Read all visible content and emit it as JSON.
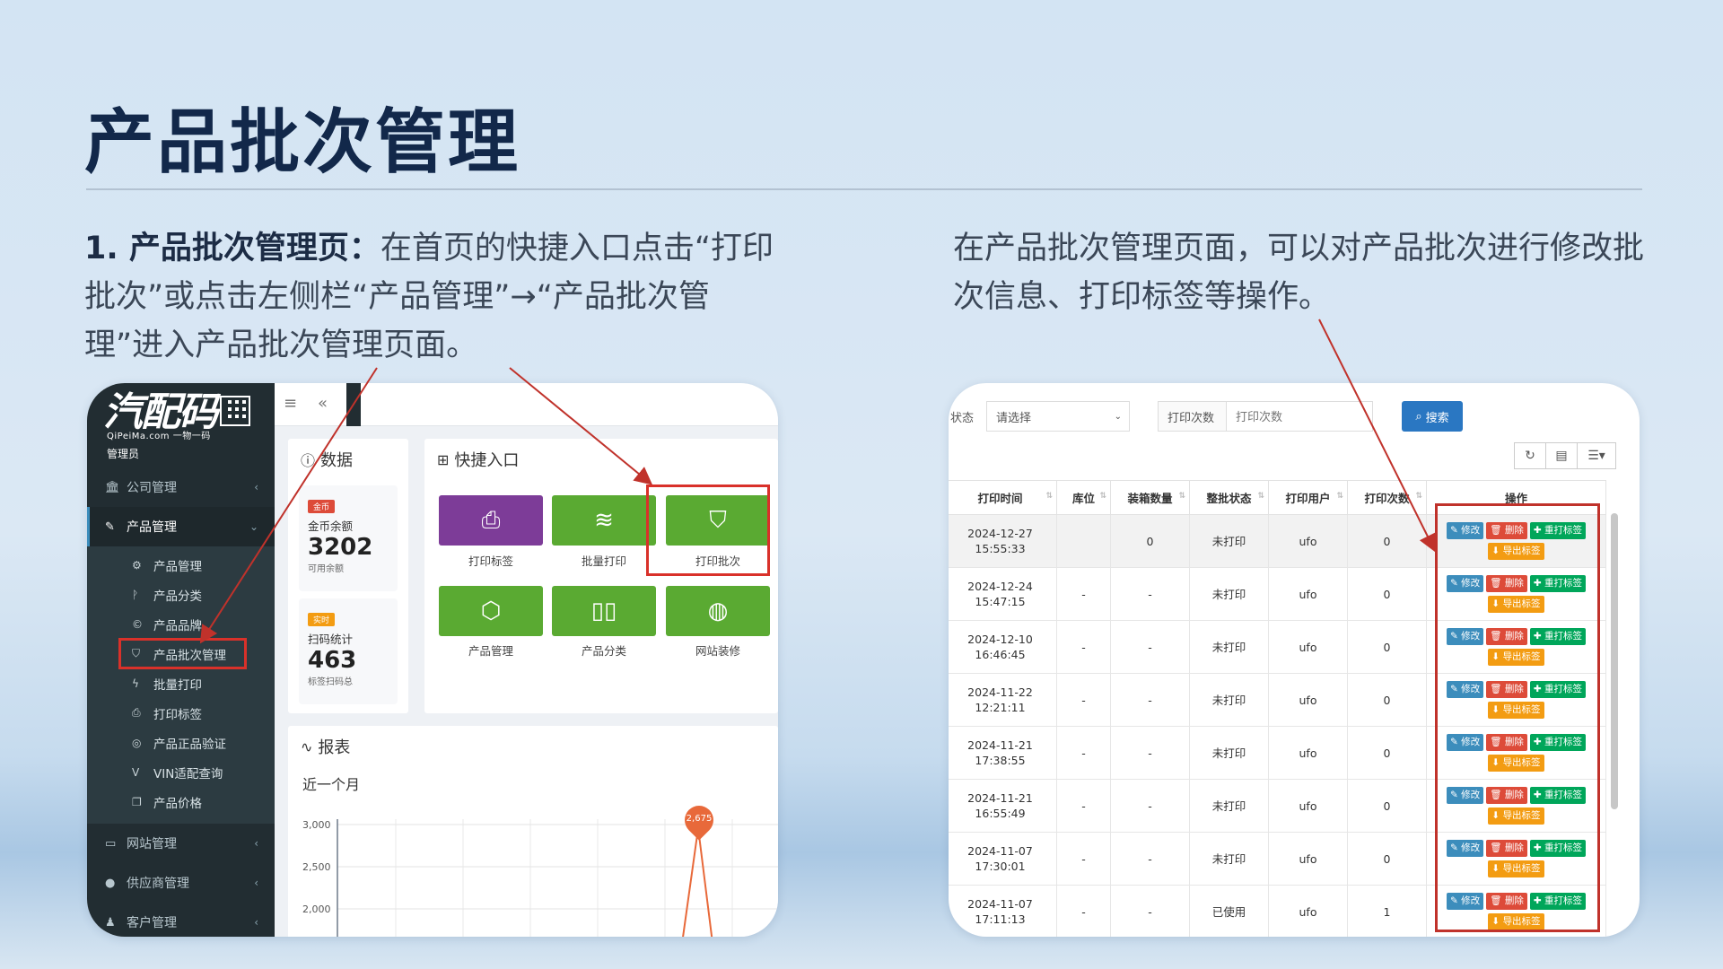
{
  "slide": {
    "title": "产品批次管理",
    "left_text_bold": "1. 产品批次管理页：",
    "left_text": "在首页的快捷入口点击“打印批次”或点击左侧栏“产品管理”→“产品批次管理”进入产品批次管理页面。",
    "right_text": "在产品批次管理页面，可以对产品批次进行修改批次信息、打印标签等操作。"
  },
  "left_shot": {
    "logo": {
      "main": "汽配码",
      "sub": "QiPeiMa.com 一物一码",
      "role": "管理员"
    },
    "sidebar": {
      "sections": [
        {
          "label": "公司管理",
          "icon": "bank-icon"
        },
        {
          "label": "产品管理",
          "icon": "wrench-icon"
        }
      ],
      "sub_items": [
        {
          "label": "产品管理",
          "icon": "gears-icon"
        },
        {
          "label": "产品分类",
          "icon": "branch-icon"
        },
        {
          "label": "产品品牌",
          "icon": "copyright-icon"
        },
        {
          "label": "产品批次管理",
          "icon": "shield-icon"
        },
        {
          "label": "批量打印",
          "icon": "bolt-icon"
        },
        {
          "label": "打印标签",
          "icon": "print-icon"
        },
        {
          "label": "产品正品验证",
          "icon": "fingerprint-icon"
        },
        {
          "label": "VIN适配查询",
          "icon": "vimeo-icon"
        },
        {
          "label": "产品价格",
          "icon": "copy-icon"
        }
      ],
      "bottom_sections": [
        {
          "label": "网站管理",
          "icon": "monitor-icon"
        },
        {
          "label": "供应商管理",
          "icon": "globe-icon"
        },
        {
          "label": "客户管理",
          "icon": "user-icon"
        }
      ]
    },
    "data_panel": {
      "title": "数据",
      "cards": [
        {
          "badge": "金币",
          "badge_color": "#dd4b39",
          "label": "金币余额",
          "value": "3202",
          "sub": "可用余额"
        },
        {
          "badge": "实时",
          "badge_color": "#f39c12",
          "label": "扫码统计",
          "value": "463",
          "sub": "标签扫码总"
        }
      ]
    },
    "quick_panel": {
      "title": "快捷入口",
      "tiles": [
        {
          "label": "打印标签",
          "icon": "print-icon",
          "color": "#7d3c98"
        },
        {
          "label": "批量打印",
          "icon": "layers-icon",
          "color": "#5aaa32"
        },
        {
          "label": "打印批次",
          "icon": "shield-check-icon",
          "color": "#5aaa32"
        },
        {
          "label": "产品管理",
          "icon": "cube-icon",
          "color": "#5aaa32"
        },
        {
          "label": "产品分类",
          "icon": "columns-icon",
          "color": "#5aaa32"
        },
        {
          "label": "网站装修",
          "icon": "globe-icon",
          "color": "#5aaa32"
        }
      ]
    },
    "report_panel": {
      "title": "报表",
      "subtitle": "近一个月",
      "y_ticks": [
        "3,000",
        "2,500",
        "2,000"
      ],
      "peak_label": "2,675"
    }
  },
  "right_shot": {
    "filters": {
      "status_label": "状态",
      "status_value": "请选择",
      "count_label": "打印次数",
      "count_placeholder": "打印次数",
      "search_label": "搜索"
    },
    "table": {
      "columns": [
        "打印时间",
        "库位",
        "装箱数量",
        "整批状态",
        "打印用户",
        "打印次数",
        "操作"
      ],
      "rows": [
        {
          "date": "2024-12-27",
          "time": "15:55:33",
          "loc": "",
          "qty": "0",
          "status": "未打印",
          "user": "ufo",
          "count": "0"
        },
        {
          "date": "2024-12-24",
          "time": "15:47:15",
          "loc": "-",
          "qty": "-",
          "status": "未打印",
          "user": "ufo",
          "count": "0"
        },
        {
          "date": "2024-12-10",
          "time": "16:46:45",
          "loc": "-",
          "qty": "-",
          "status": "未打印",
          "user": "ufo",
          "count": "0"
        },
        {
          "date": "2024-11-22",
          "time": "12:21:11",
          "loc": "-",
          "qty": "-",
          "status": "未打印",
          "user": "ufo",
          "count": "0"
        },
        {
          "date": "2024-11-21",
          "time": "17:38:55",
          "loc": "-",
          "qty": "-",
          "status": "未打印",
          "user": "ufo",
          "count": "0"
        },
        {
          "date": "2024-11-21",
          "time": "16:55:49",
          "loc": "-",
          "qty": "-",
          "status": "未打印",
          "user": "ufo",
          "count": "0"
        },
        {
          "date": "2024-11-07",
          "time": "17:30:01",
          "loc": "-",
          "qty": "-",
          "status": "未打印",
          "user": "ufo",
          "count": "0"
        },
        {
          "date": "2024-11-07",
          "time": "17:11:13",
          "loc": "-",
          "qty": "-",
          "status": "已使用",
          "user": "ufo",
          "count": "1"
        }
      ],
      "actions": {
        "edit": "修改",
        "delete": "删除",
        "reprint": "重打标签",
        "export": "导出标签"
      }
    }
  },
  "colors": {
    "highlight": "#d9312a",
    "title": "#12284a",
    "sidebar": "#222d32"
  }
}
